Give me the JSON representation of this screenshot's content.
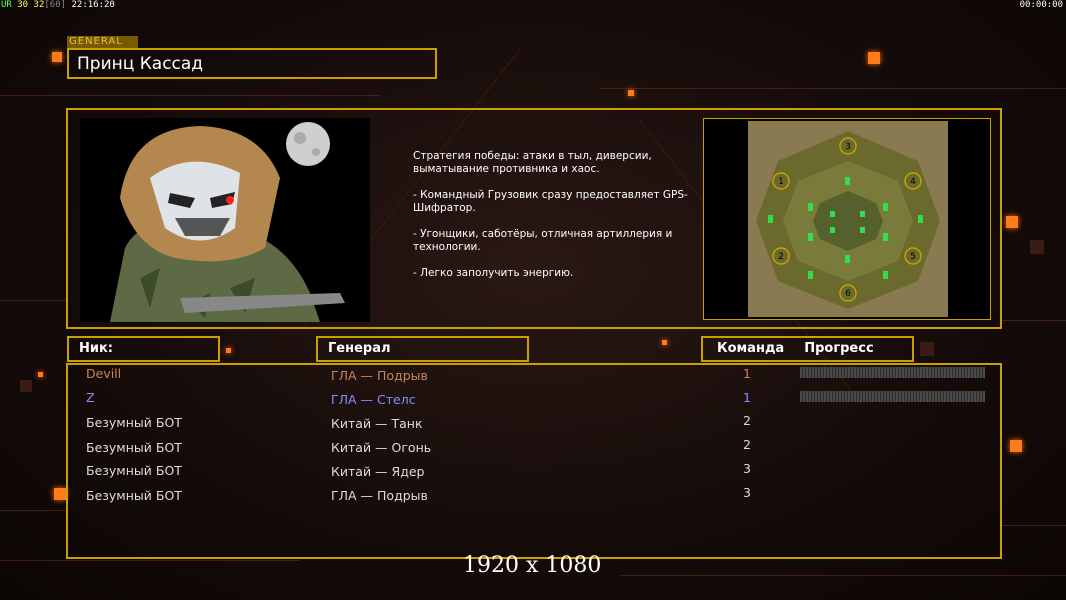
{
  "osd": {
    "left": "UR 30 32[60] 22:16:20",
    "right": "00:00:00"
  },
  "general_tag": "GENERAL",
  "general_name": "Принц Кассад",
  "description": [
    "Стратегия победы: атаки в тыл, диверсии, выматывание противника и хаос.",
    "- Командный Грузовик сразу предоставляет GPS-Шифратор.",
    "- Угонщики, саботёры, отличная артиллерия и технологии.",
    "- Легко заполучить энергию."
  ],
  "columns": {
    "nick": "Ник:",
    "general": "Генерал",
    "team": "Команда",
    "progress": "Прогресс"
  },
  "players": [
    {
      "nick": "Devill",
      "general": "ГЛА — Подрыв",
      "team": "1",
      "color": "#c8845a",
      "progress": 0
    },
    {
      "nick": "Z",
      "general": "ГЛА — Стелс",
      "team": "1",
      "color": "#8a8cff",
      "progress": 0
    },
    {
      "nick": "Безумный БОТ",
      "general": "Китай — Танк",
      "team": "2",
      "color": "#ffffff"
    },
    {
      "nick": "Безумный БОТ",
      "general": "Китай — Огонь",
      "team": "2",
      "color": "#ffffff"
    },
    {
      "nick": "Безумный БОТ",
      "general": "Китай — Ядер",
      "team": "3",
      "color": "#ffffff"
    },
    {
      "nick": "Безумный БОТ",
      "general": "ГЛА — Подрыв",
      "team": "3",
      "color": "#ffffff"
    }
  ],
  "map_start_positions": [
    "1",
    "2",
    "3",
    "4",
    "5",
    "6"
  ],
  "resolution_watermark": "1920 x 1080",
  "colors": {
    "accent": "#c8a000",
    "glow": "#ff7a1a"
  }
}
